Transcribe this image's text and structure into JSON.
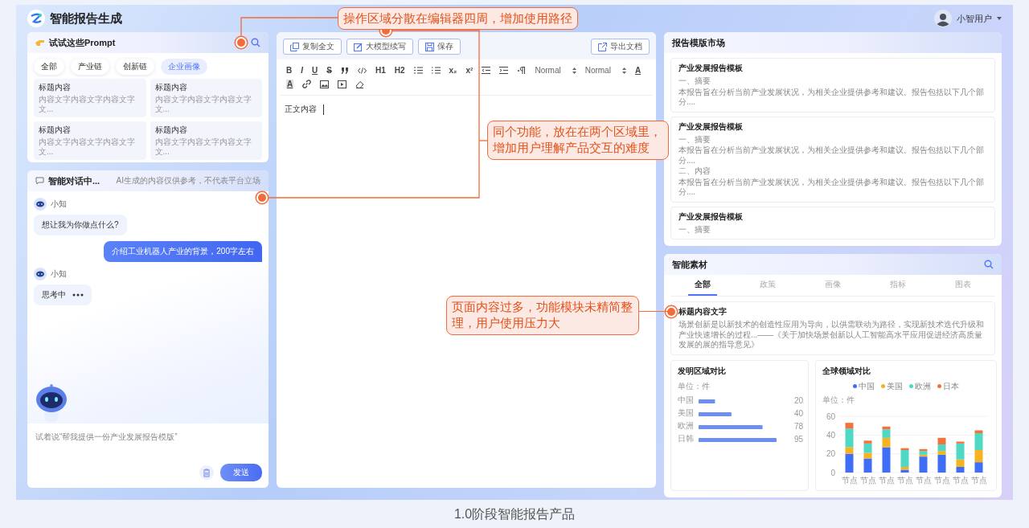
{
  "app": {
    "title": "智能报告生成"
  },
  "user": {
    "name": "小智用户"
  },
  "prompts": {
    "title": "试试这些Prompt",
    "chips": [
      {
        "label": "全部",
        "selected": false
      },
      {
        "label": "产业链",
        "selected": false
      },
      {
        "label": "创新链",
        "selected": false
      },
      {
        "label": "企业画像",
        "selected": true
      }
    ],
    "items": [
      {
        "title": "标题内容",
        "text": "内容文字内容文字内容文字文..."
      },
      {
        "title": "标题内容",
        "text": "内容文字内容文字内容文字文..."
      },
      {
        "title": "标题内容",
        "text": "内容文字内容文字内容文字文..."
      },
      {
        "title": "标题内容",
        "text": "内容文字内容文字内容文字文..."
      }
    ]
  },
  "chat": {
    "title": "智能对话中...",
    "notice": "AI生成的内容仅供参考，不代表平台立场",
    "messages": [
      {
        "kind": "bot",
        "name": "小知",
        "text": "想让我为你做点什么?"
      },
      {
        "kind": "user",
        "text": "介绍工业机器人产业的背景，200字左右"
      },
      {
        "kind": "thinking",
        "name": "小知",
        "text": "思考中"
      }
    ],
    "input": {
      "placeholder": "试着说“帮我提供一份产业发展报告模版”"
    },
    "send": "发送"
  },
  "editor": {
    "actions": [
      {
        "kind": "copy",
        "label": "复制全文"
      },
      {
        "kind": "write",
        "label": "大模型续写"
      },
      {
        "kind": "save",
        "label": "保存"
      }
    ],
    "export": "导出文档",
    "format": [
      "B",
      "I",
      "U",
      "S"
    ],
    "headings": [
      "H1",
      "H2"
    ],
    "scripts": [
      "x₂",
      "x²"
    ],
    "selects": [
      "Normal",
      "Normal"
    ],
    "colors": [
      "A",
      "A"
    ],
    "body": "正文内容"
  },
  "templates": {
    "title": "报告模版市场",
    "cards": [
      {
        "title": "产业发展报告模板",
        "sections": [
          {
            "heading": "一、摘要",
            "text": "本报告旨在分析当前产业发展状况，为相关企业提供参考和建议。报告包括以下几个部分...."
          }
        ]
      },
      {
        "title": "产业发展报告模板",
        "sections": [
          {
            "heading": "一、摘要",
            "text": "本报告旨在分析当前产业发展状况，为相关企业提供参考和建议。报告包括以下几个部分...."
          },
          {
            "heading": "二、内容",
            "text": "本报告旨在分析当前产业发展状况，为相关企业提供参考和建议。报告包括以下几个部分...."
          }
        ]
      },
      {
        "title": "产业发展报告模板",
        "sections": [
          {
            "heading": "一、摘要"
          }
        ]
      }
    ]
  },
  "materials": {
    "title": "智能素材",
    "tabs": [
      {
        "label": "全部",
        "selected": true
      },
      {
        "label": "政策",
        "selected": false
      },
      {
        "label": "画像",
        "selected": false
      },
      {
        "label": "指标",
        "selected": false
      },
      {
        "label": "图表",
        "selected": false
      }
    ],
    "article": {
      "title": "标题内容文字",
      "text": "场景创新是以新技术的创造性应用为导向，以供需联动为路径，实现新技术迭代升级和产业快速增长的过程...——《关于加快场景创新以人工智能高水平应用促进经济高质量发展的展的指导意见》"
    },
    "charts": [
      {
        "unit": "单位：件",
        "chart_data": {
          "type": "bar",
          "orientation": "horizontal",
          "title": "发明区域对比",
          "categories": [
            "中国",
            "美国",
            "欧洲",
            "日韩"
          ],
          "values": [
            20,
            40,
            78,
            95
          ],
          "data_labels": true
        }
      },
      {
        "unit": "单位：件",
        "chart_data": {
          "type": "bar",
          "stacked": true,
          "title": "全球领域对比",
          "categories": [
            "节点",
            "节点",
            "节点",
            "节点",
            "节点",
            "节点",
            "节点",
            "节点"
          ],
          "series": [
            {
              "name": "中国",
              "color": "#3d6ef5",
              "values": [
                20,
                15,
                27,
                3,
                17,
                19,
                6,
                11
              ]
            },
            {
              "name": "美国",
              "color": "#f7b21f",
              "values": [
                7,
                6,
                10,
                3,
                2,
                4,
                8,
                13
              ]
            },
            {
              "name": "欧洲",
              "color": "#4fd8c4",
              "values": [
                20,
                10,
                9,
                18,
                4,
                7,
                17,
                18
              ]
            },
            {
              "name": "日本",
              "color": "#f5703a",
              "values": [
                6,
                3,
                3,
                2,
                2,
                7,
                2,
                3
              ]
            }
          ],
          "ylim": [
            0,
            60
          ],
          "yticks": [
            0,
            20,
            40,
            60
          ]
        }
      }
    ]
  },
  "annotations": [
    {
      "text": "操作区域分散在编辑器四周，增加使用路径"
    },
    {
      "text": "同个功能，放在在两个区域里，增加用户理解产品交互的难度"
    },
    {
      "text": "页面内容过多，功能模块未精简整理，用户使用压力大"
    }
  ],
  "caption": "1.0阶段智能报告产品"
}
